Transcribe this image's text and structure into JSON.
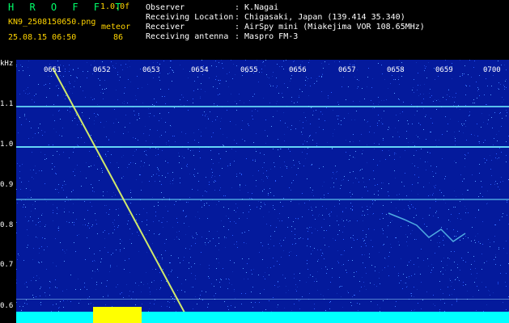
{
  "header": {
    "app_title": "H R O F F T",
    "version": "1.0.0f",
    "filename": "KN9_2508150650.png",
    "meteor_label": "meteor",
    "meteor_count": "86",
    "datetime": "25.08.15 06:50",
    "observer_label": "Observer",
    "observer_value": ": K.Nagai",
    "location_label": "Receiving Location",
    "location_value": ": Chigasaki, Japan (139.414 35.340)",
    "receiver_label": "Receiver",
    "receiver_value": ": AirSpy mini (Miakejima VOR 108.65MHz)",
    "antenna_label": "Receiving antenna",
    "antenna_value": ": Maspro FM-3"
  },
  "axis": {
    "unit": "kHz",
    "ticks": [
      "1.1",
      "1.0",
      "0.9",
      "0.8",
      "0.7",
      "0.6"
    ]
  },
  "timeline": {
    "labels": [
      "0651",
      "0652",
      "0653",
      "0654",
      "0655",
      "0656",
      "0657",
      "0658",
      "0659",
      "0700"
    ]
  },
  "colors": {
    "background": "#041a9c",
    "signal": "#7ff0ff",
    "meteor_trail": "#e6ff66",
    "baseline": "#ffff00",
    "title": "#00ff6a"
  }
}
